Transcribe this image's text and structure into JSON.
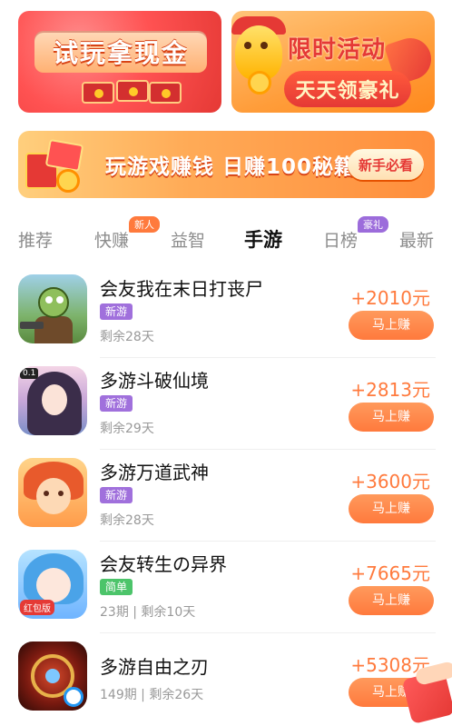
{
  "banners": {
    "trial_cash": {
      "title": "试玩拿现金"
    },
    "limited_event": {
      "title": "限时活动",
      "subtitle": "天天领豪礼"
    },
    "guide": {
      "text": "玩游戏赚钱 日赚100秘籍",
      "button": "新手必看"
    }
  },
  "tabs": [
    {
      "label": "推荐",
      "badge": ""
    },
    {
      "label": "快赚",
      "badge": "新人"
    },
    {
      "label": "益智",
      "badge": ""
    },
    {
      "label": "手游",
      "badge": "",
      "active": true
    },
    {
      "label": "日榜",
      "badge": "豪礼"
    },
    {
      "label": "最新",
      "badge": ""
    }
  ],
  "games": [
    {
      "name": "会友我在末日打丧尸",
      "tag": "新游",
      "tag_color": "#a070dc",
      "meta": "剩余28天",
      "reward": "+2010元",
      "button": "马上赚",
      "icon": "zombie-game-icon"
    },
    {
      "name": "多游斗破仙境",
      "tag": "新游",
      "tag_color": "#a070dc",
      "meta": "剩余29天",
      "reward": "+2813元",
      "button": "马上赚",
      "icon": "fairy-game-icon"
    },
    {
      "name": "多游万道武神",
      "tag": "新游",
      "tag_color": "#a070dc",
      "meta": "剩余28天",
      "reward": "+3600元",
      "button": "马上赚",
      "icon": "warrior-game-icon"
    },
    {
      "name": "会友转生の异界",
      "tag": "简单",
      "tag_color": "#4cc46a",
      "meta": "23期 | 剩余10天",
      "reward": "+7665元",
      "button": "马上赚",
      "icon": "anime-game-icon"
    },
    {
      "name": "多游自由之刃",
      "tag": "",
      "tag_color": "",
      "meta": "149期 | 剩余26天",
      "reward": "+5308元",
      "button": "马上赚",
      "icon": "blade-game-icon"
    }
  ],
  "icon_labels": {
    "fairy_badge": "0.1",
    "anime_badge": "红包版"
  },
  "colors": {
    "accent": "#ff7a3d",
    "tag_purple": "#a070dc",
    "tag_green": "#4cc46a"
  }
}
